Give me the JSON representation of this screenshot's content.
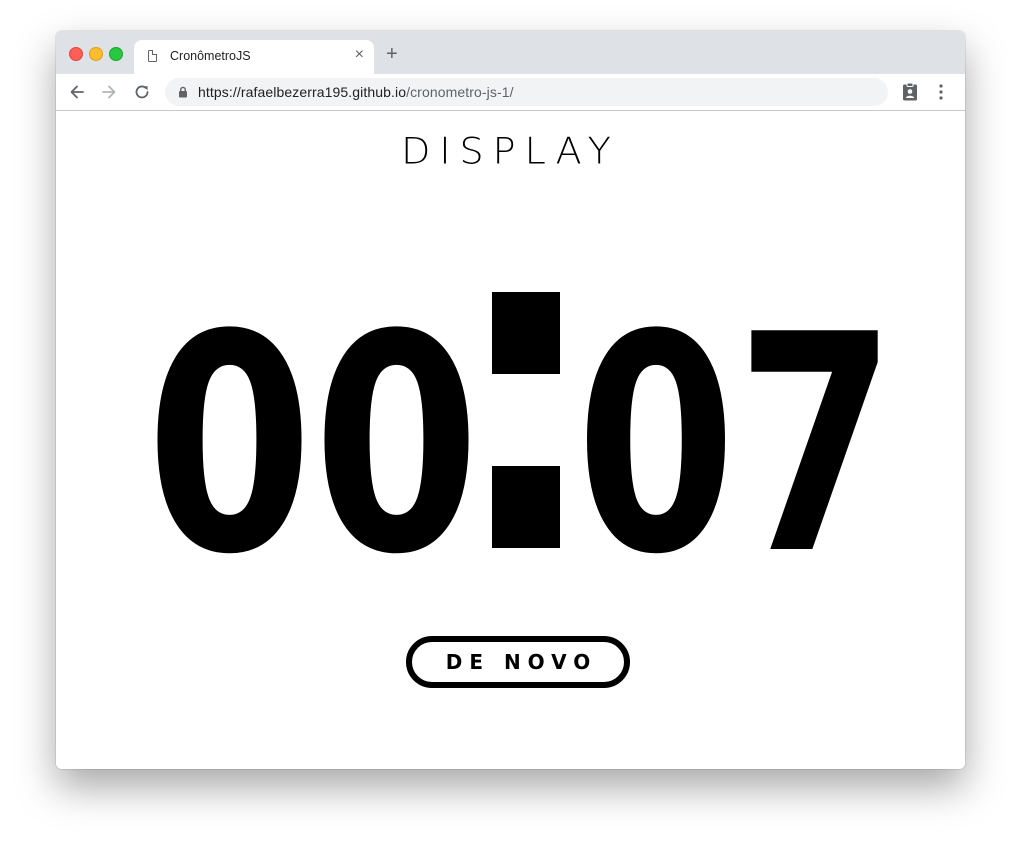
{
  "browser": {
    "tab": {
      "title": "CronômetroJS",
      "close_glyph": "×"
    },
    "new_tab_glyph": "+",
    "address": {
      "host": "https://rafaelbezerra195.github.io",
      "path": "/cronometro-js-1/"
    },
    "icons": {
      "back": "arrow-left-icon",
      "forward": "arrow-right-icon",
      "reload": "reload-icon",
      "lock": "lock-icon",
      "extension": "clipboard-badge-icon",
      "menu": "kebab-menu-icon",
      "page": "document-icon"
    }
  },
  "page": {
    "heading": "DISPLAY",
    "timer": {
      "minutes": "00",
      "seconds": "07"
    },
    "again_button": "DE NOVO"
  },
  "colors": {
    "tabstrip": "#dee1e6",
    "omnibox": "#f1f3f4",
    "text": "#000000"
  }
}
